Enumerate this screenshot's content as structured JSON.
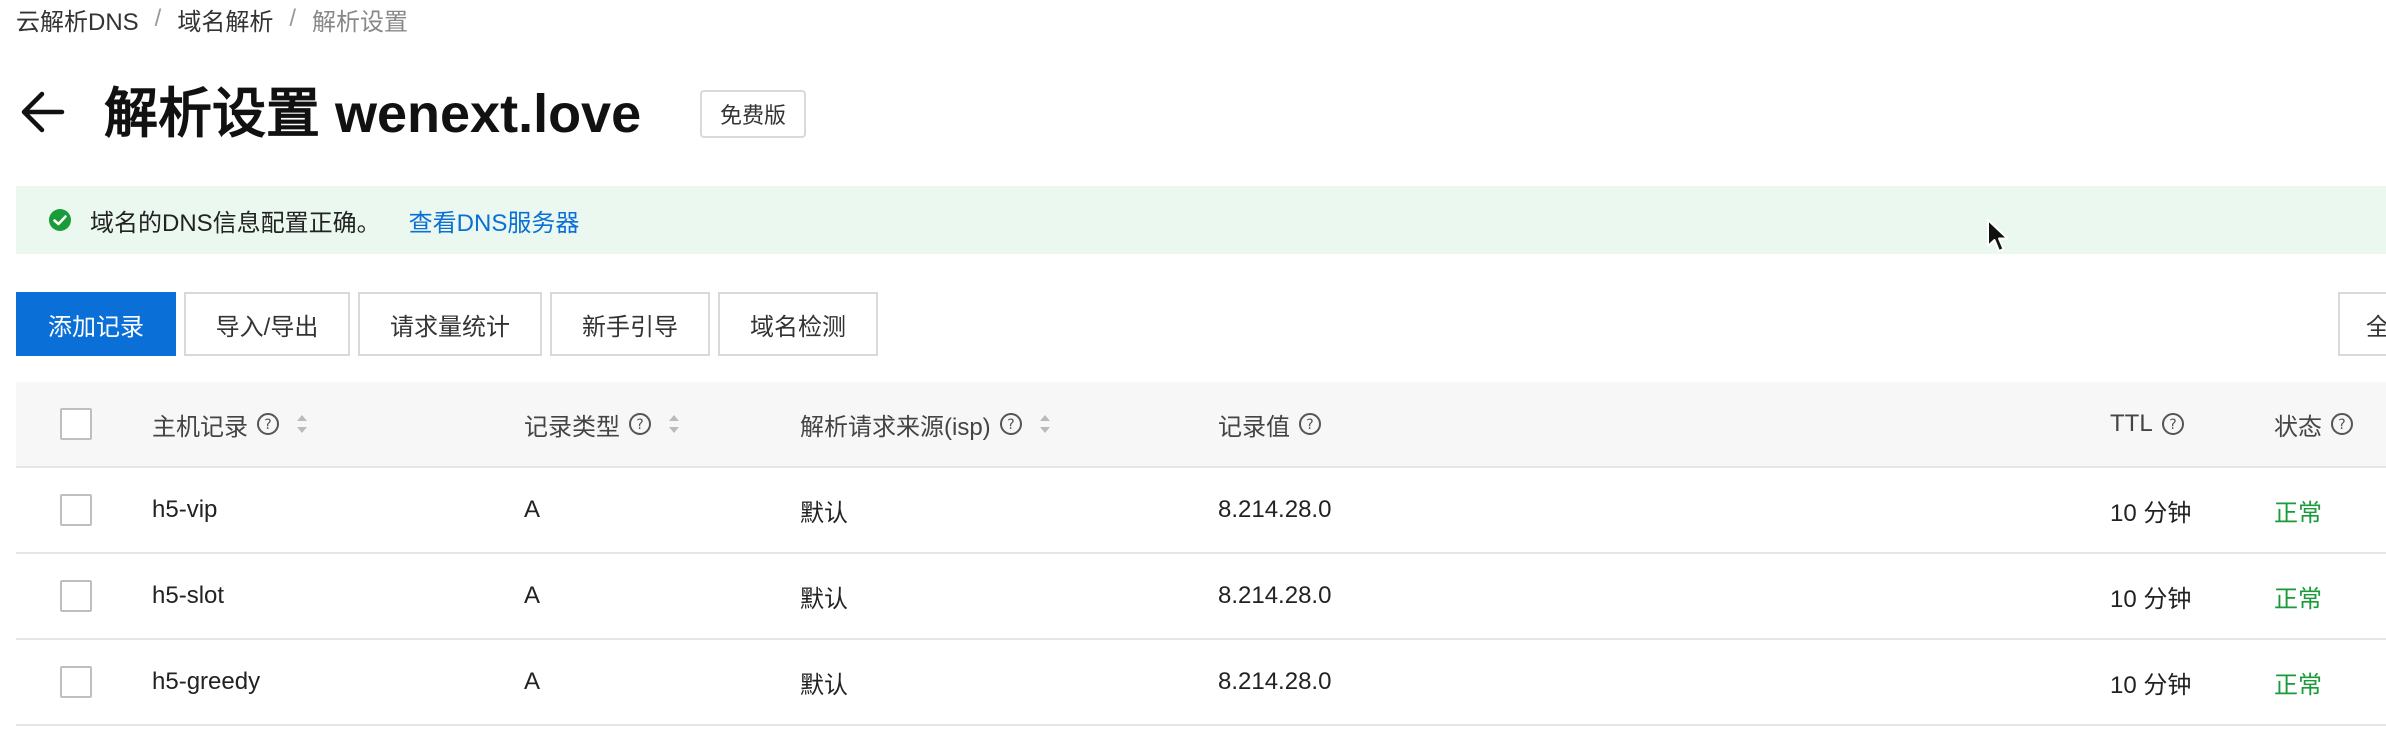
{
  "breadcrumb": {
    "items": [
      "云解析DNS",
      "域名解析",
      "解析设置"
    ],
    "separator": "/"
  },
  "header": {
    "title": "解析设置 wenext.love",
    "plan_badge": "免费版"
  },
  "alert": {
    "message": "域名的DNS信息配置正确。",
    "link": "查看DNS服务器",
    "status_color": "#1a9b3a"
  },
  "toolbar": {
    "add_record": "添加记录",
    "import_export": "导入/导出",
    "request_stats": "请求量统计",
    "beginner_guide": "新手引导",
    "domain_check": "域名检测",
    "right_button_partial": "全"
  },
  "table": {
    "columns": {
      "host": "主机记录",
      "type": "记录类型",
      "isp": "解析请求来源(isp)",
      "value": "记录值",
      "ttl": "TTL",
      "status": "状态"
    },
    "rows": [
      {
        "host": "h5-vip",
        "type": "A",
        "isp": "默认",
        "value": "8.214.28.0",
        "ttl": "10 分钟",
        "status": "正常"
      },
      {
        "host": "h5-slot",
        "type": "A",
        "isp": "默认",
        "value": "8.214.28.0",
        "ttl": "10 分钟",
        "status": "正常"
      },
      {
        "host": "h5-greedy",
        "type": "A",
        "isp": "默认",
        "value": "8.214.28.0",
        "ttl": "10 分钟",
        "status": "正常"
      }
    ]
  },
  "colors": {
    "primary": "#0a6fd6",
    "alert_bg": "#ebf8ef",
    "status_ok": "#1a9b3a"
  }
}
